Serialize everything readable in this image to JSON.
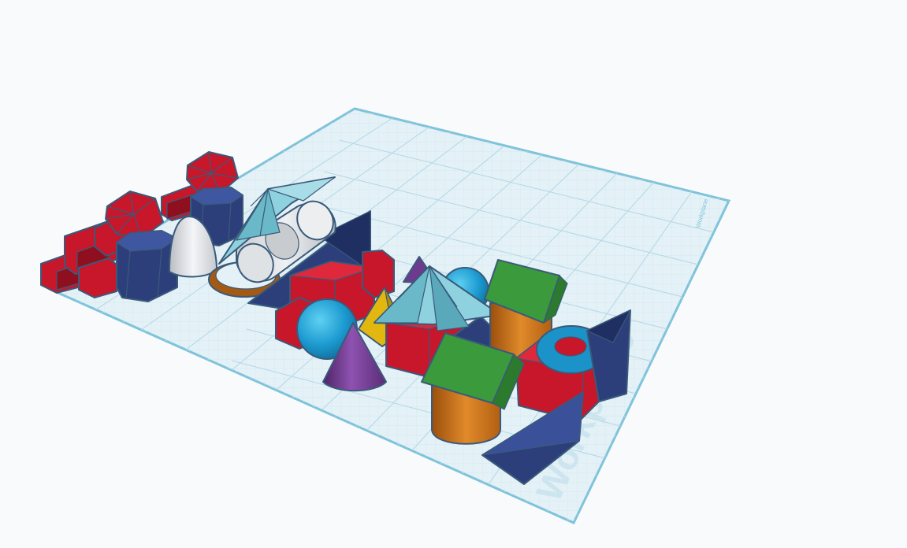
{
  "workplane": {
    "label_small": "Workplane",
    "label_large": "Workplane"
  },
  "colors": {
    "background": "#f9fafb",
    "grid_fill": "#e4f1f6",
    "grid_line": "#b9dbe8",
    "grid_border": "#7ec3da",
    "red": "#c8162a",
    "navy": "#2c3f7a",
    "sky": "#7cc7d6",
    "green": "#3a9a3c",
    "orange": "#d2771e",
    "purple": "#6c3b8e",
    "yellow": "#e1b710",
    "white_shape": "#e9ecef",
    "torus": "#1b93c8"
  },
  "shapes": [
    "box",
    "icosahedron",
    "hexagonal-prism",
    "paraboloid",
    "cylinder",
    "wedge",
    "roof",
    "sphere",
    "cone",
    "pyramid",
    "torus",
    "ring",
    "letter-text"
  ]
}
